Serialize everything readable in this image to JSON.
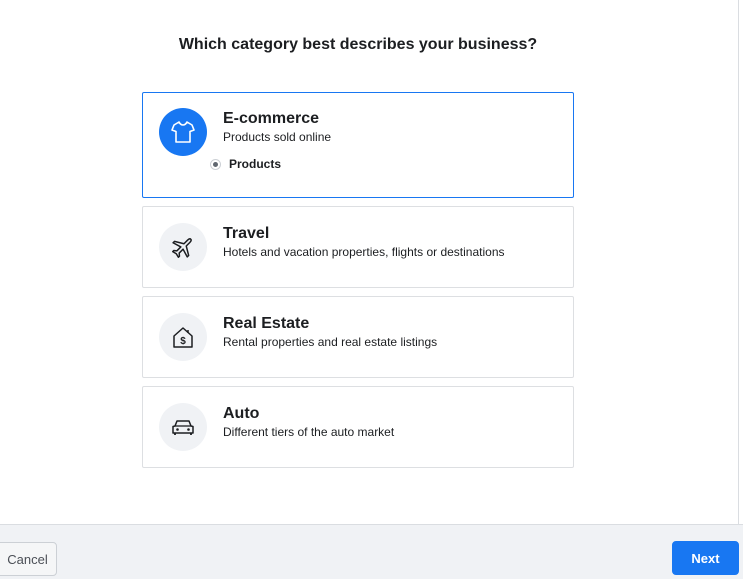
{
  "title": "Which category best describes your business?",
  "categories": [
    {
      "title": "E-commerce",
      "description": "Products sold online",
      "icon": "tshirt-icon",
      "selected": true,
      "sub_option": "Products"
    },
    {
      "title": "Travel",
      "description": "Hotels and vacation properties, flights or destinations",
      "icon": "airplane-icon",
      "selected": false
    },
    {
      "title": "Real Estate",
      "description": "Rental properties and real estate listings",
      "icon": "house-dollar-icon",
      "selected": false
    },
    {
      "title": "Auto",
      "description": "Different tiers of the auto market",
      "icon": "car-icon",
      "selected": false
    }
  ],
  "footer": {
    "cancel_label": "Cancel",
    "next_label": "Next"
  },
  "colors": {
    "accent": "#1877f2",
    "icon_bg": "#f0f2f5",
    "border": "#dddfe2"
  }
}
